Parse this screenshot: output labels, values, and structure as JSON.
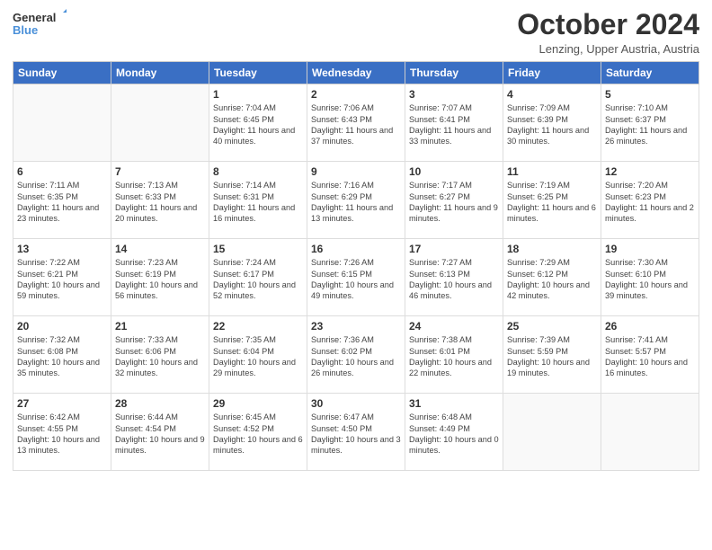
{
  "header": {
    "logo_line1": "General",
    "logo_line2": "Blue",
    "month_title": "October 2024",
    "location": "Lenzing, Upper Austria, Austria"
  },
  "days_of_week": [
    "Sunday",
    "Monday",
    "Tuesday",
    "Wednesday",
    "Thursday",
    "Friday",
    "Saturday"
  ],
  "weeks": [
    [
      {
        "day": "",
        "info": ""
      },
      {
        "day": "",
        "info": ""
      },
      {
        "day": "1",
        "info": "Sunrise: 7:04 AM\nSunset: 6:45 PM\nDaylight: 11 hours\nand 40 minutes."
      },
      {
        "day": "2",
        "info": "Sunrise: 7:06 AM\nSunset: 6:43 PM\nDaylight: 11 hours\nand 37 minutes."
      },
      {
        "day": "3",
        "info": "Sunrise: 7:07 AM\nSunset: 6:41 PM\nDaylight: 11 hours\nand 33 minutes."
      },
      {
        "day": "4",
        "info": "Sunrise: 7:09 AM\nSunset: 6:39 PM\nDaylight: 11 hours\nand 30 minutes."
      },
      {
        "day": "5",
        "info": "Sunrise: 7:10 AM\nSunset: 6:37 PM\nDaylight: 11 hours\nand 26 minutes."
      }
    ],
    [
      {
        "day": "6",
        "info": "Sunrise: 7:11 AM\nSunset: 6:35 PM\nDaylight: 11 hours\nand 23 minutes."
      },
      {
        "day": "7",
        "info": "Sunrise: 7:13 AM\nSunset: 6:33 PM\nDaylight: 11 hours\nand 20 minutes."
      },
      {
        "day": "8",
        "info": "Sunrise: 7:14 AM\nSunset: 6:31 PM\nDaylight: 11 hours\nand 16 minutes."
      },
      {
        "day": "9",
        "info": "Sunrise: 7:16 AM\nSunset: 6:29 PM\nDaylight: 11 hours\nand 13 minutes."
      },
      {
        "day": "10",
        "info": "Sunrise: 7:17 AM\nSunset: 6:27 PM\nDaylight: 11 hours\nand 9 minutes."
      },
      {
        "day": "11",
        "info": "Sunrise: 7:19 AM\nSunset: 6:25 PM\nDaylight: 11 hours\nand 6 minutes."
      },
      {
        "day": "12",
        "info": "Sunrise: 7:20 AM\nSunset: 6:23 PM\nDaylight: 11 hours\nand 2 minutes."
      }
    ],
    [
      {
        "day": "13",
        "info": "Sunrise: 7:22 AM\nSunset: 6:21 PM\nDaylight: 10 hours\nand 59 minutes."
      },
      {
        "day": "14",
        "info": "Sunrise: 7:23 AM\nSunset: 6:19 PM\nDaylight: 10 hours\nand 56 minutes."
      },
      {
        "day": "15",
        "info": "Sunrise: 7:24 AM\nSunset: 6:17 PM\nDaylight: 10 hours\nand 52 minutes."
      },
      {
        "day": "16",
        "info": "Sunrise: 7:26 AM\nSunset: 6:15 PM\nDaylight: 10 hours\nand 49 minutes."
      },
      {
        "day": "17",
        "info": "Sunrise: 7:27 AM\nSunset: 6:13 PM\nDaylight: 10 hours\nand 46 minutes."
      },
      {
        "day": "18",
        "info": "Sunrise: 7:29 AM\nSunset: 6:12 PM\nDaylight: 10 hours\nand 42 minutes."
      },
      {
        "day": "19",
        "info": "Sunrise: 7:30 AM\nSunset: 6:10 PM\nDaylight: 10 hours\nand 39 minutes."
      }
    ],
    [
      {
        "day": "20",
        "info": "Sunrise: 7:32 AM\nSunset: 6:08 PM\nDaylight: 10 hours\nand 35 minutes."
      },
      {
        "day": "21",
        "info": "Sunrise: 7:33 AM\nSunset: 6:06 PM\nDaylight: 10 hours\nand 32 minutes."
      },
      {
        "day": "22",
        "info": "Sunrise: 7:35 AM\nSunset: 6:04 PM\nDaylight: 10 hours\nand 29 minutes."
      },
      {
        "day": "23",
        "info": "Sunrise: 7:36 AM\nSunset: 6:02 PM\nDaylight: 10 hours\nand 26 minutes."
      },
      {
        "day": "24",
        "info": "Sunrise: 7:38 AM\nSunset: 6:01 PM\nDaylight: 10 hours\nand 22 minutes."
      },
      {
        "day": "25",
        "info": "Sunrise: 7:39 AM\nSunset: 5:59 PM\nDaylight: 10 hours\nand 19 minutes."
      },
      {
        "day": "26",
        "info": "Sunrise: 7:41 AM\nSunset: 5:57 PM\nDaylight: 10 hours\nand 16 minutes."
      }
    ],
    [
      {
        "day": "27",
        "info": "Sunrise: 6:42 AM\nSunset: 4:55 PM\nDaylight: 10 hours\nand 13 minutes."
      },
      {
        "day": "28",
        "info": "Sunrise: 6:44 AM\nSunset: 4:54 PM\nDaylight: 10 hours\nand 9 minutes."
      },
      {
        "day": "29",
        "info": "Sunrise: 6:45 AM\nSunset: 4:52 PM\nDaylight: 10 hours\nand 6 minutes."
      },
      {
        "day": "30",
        "info": "Sunrise: 6:47 AM\nSunset: 4:50 PM\nDaylight: 10 hours\nand 3 minutes."
      },
      {
        "day": "31",
        "info": "Sunrise: 6:48 AM\nSunset: 4:49 PM\nDaylight: 10 hours\nand 0 minutes."
      },
      {
        "day": "",
        "info": ""
      },
      {
        "day": "",
        "info": ""
      }
    ]
  ]
}
